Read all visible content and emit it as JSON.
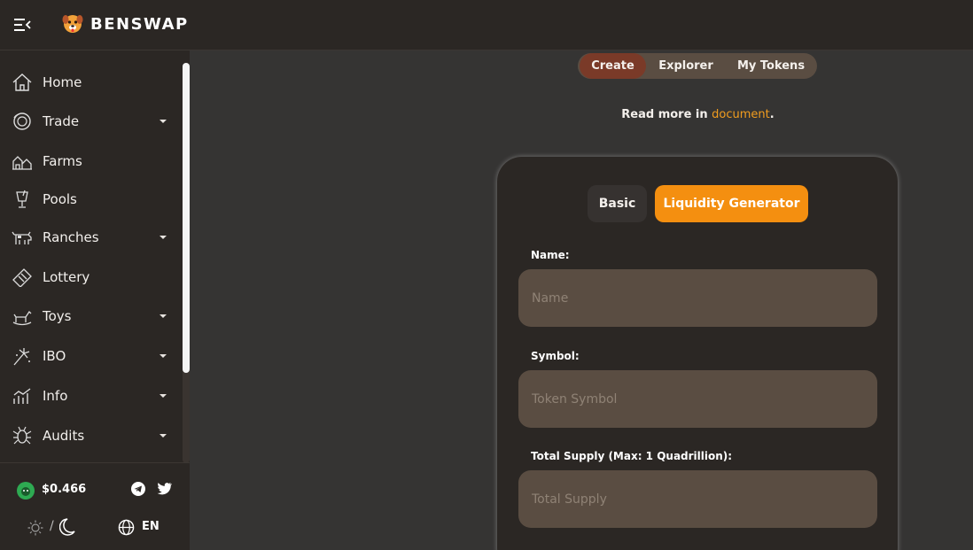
{
  "brand": {
    "title": "BENSWAP"
  },
  "sidebar": {
    "items": [
      {
        "label": "Home",
        "icon": "home-icon",
        "has_caret": false
      },
      {
        "label": "Trade",
        "icon": "trade-icon",
        "has_caret": true
      },
      {
        "label": "Farms",
        "icon": "farm-icon",
        "has_caret": false
      },
      {
        "label": "Pools",
        "icon": "pool-icon",
        "has_caret": false
      },
      {
        "label": "Ranches",
        "icon": "cow-icon",
        "has_caret": true
      },
      {
        "label": "Lottery",
        "icon": "ticket-icon",
        "has_caret": false
      },
      {
        "label": "Toys",
        "icon": "rocking-horse-icon",
        "has_caret": true
      },
      {
        "label": "IBO",
        "icon": "fireworks-icon",
        "has_caret": true
      },
      {
        "label": "Info",
        "icon": "chart-icon",
        "has_caret": true
      },
      {
        "label": "Audits",
        "icon": "bug-icon",
        "has_caret": true
      }
    ],
    "footer": {
      "price": "$0.466",
      "theme_separator": "/",
      "language": "EN"
    }
  },
  "tabs": [
    {
      "label": "Create",
      "active": true
    },
    {
      "label": "Explorer",
      "active": false
    },
    {
      "label": "My Tokens",
      "active": false
    }
  ],
  "readmore": {
    "prefix": "Read more in ",
    "link": "document",
    "suffix": "."
  },
  "form": {
    "mode_basic": "Basic",
    "mode_liquidity": "Liquidity Generator",
    "fields": [
      {
        "label": "Name:",
        "placeholder": "Name",
        "value": ""
      },
      {
        "label": "Symbol:",
        "placeholder": "Token Symbol",
        "value": ""
      },
      {
        "label": "Total Supply (Max: 1 Quadrillion):",
        "placeholder": "Total Supply",
        "value": ""
      }
    ]
  },
  "colors": {
    "accent": "#f48f10",
    "active_tab": "#7a3a28",
    "input_bg": "#5a4d42",
    "panel_bg": "#2b2724",
    "link": "#f29d1f"
  }
}
